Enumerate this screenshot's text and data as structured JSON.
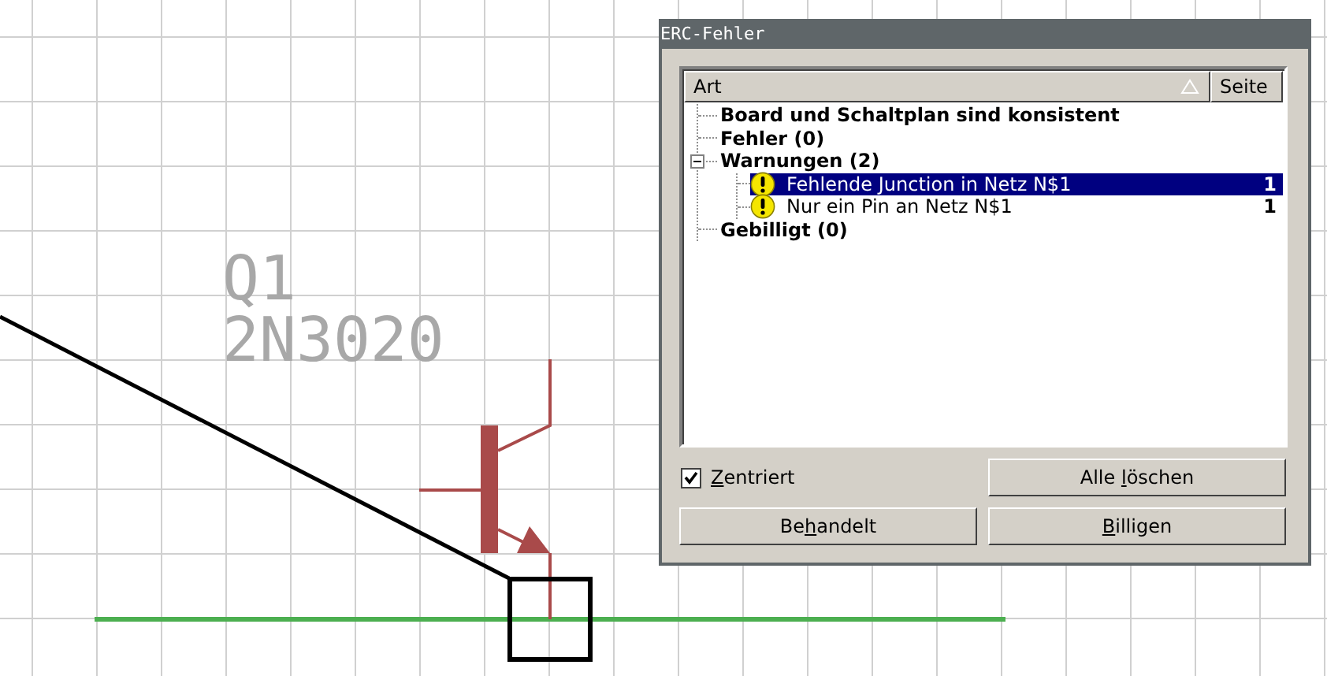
{
  "canvas": {
    "part_name": "Q1",
    "part_value": "2N3020"
  },
  "dialog": {
    "title": "ERC-Fehler",
    "columns": [
      {
        "label": "Art",
        "sorted": true
      },
      {
        "label": "Seite",
        "sorted": false
      }
    ],
    "tree": [
      {
        "label": "Board und Schaltplan sind konsistent",
        "kind": "group",
        "selected": false
      },
      {
        "label": "Fehler (0)",
        "kind": "group",
        "selected": false
      },
      {
        "label": "Warnungen (2)",
        "kind": "group",
        "selected": false,
        "expanded": true,
        "children": [
          {
            "label": "Fehlende Junction in Netz N$1",
            "kind": "warning",
            "page": "1",
            "selected": true
          },
          {
            "label": "Nur ein Pin an Netz N$1",
            "kind": "warning",
            "page": "1",
            "selected": false
          }
        ]
      },
      {
        "label": "Gebilligt (0)",
        "kind": "group",
        "selected": false
      }
    ],
    "checkbox": {
      "mnemonic": "Z",
      "label_rest": "entriert",
      "checked": true
    },
    "buttons": [
      {
        "label_start": "Alle ",
        "mnemonic": "l",
        "label_rest": "öschen"
      },
      {
        "label_start": "Be",
        "mnemonic": "h",
        "label_rest": "andelt"
      },
      {
        "mnemonic": "B",
        "label_rest": "illigen"
      }
    ]
  }
}
